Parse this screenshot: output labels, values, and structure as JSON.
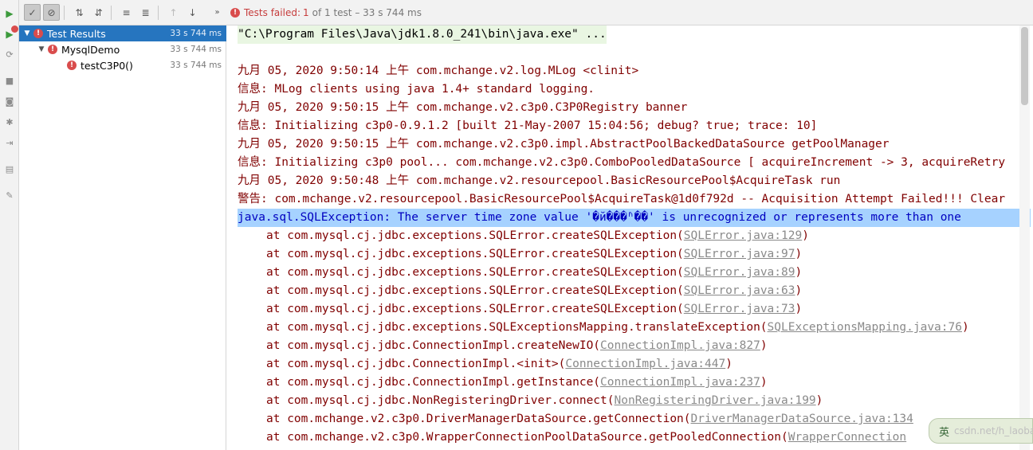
{
  "toolbar": {
    "status_fail": "Tests failed:",
    "status_count": "1",
    "status_rest": "of 1 test – 33 s 744 ms"
  },
  "tree": {
    "items": [
      {
        "label": "Test Results",
        "duration": "33 s 744 ms"
      },
      {
        "label": "MysqlDemo",
        "duration": "33 s 744 ms"
      },
      {
        "label": "testC3P0()",
        "duration": "33 s 744 ms"
      }
    ]
  },
  "console": {
    "command": "\"C:\\Program Files\\Java\\jdk1.8.0_241\\bin\\java.exe\" ...",
    "lines": [
      "九月 05, 2020 9:50:14 上午 com.mchange.v2.log.MLog <clinit>",
      "信息: MLog clients using java 1.4+ standard logging.",
      "九月 05, 2020 9:50:15 上午 com.mchange.v2.c3p0.C3P0Registry banner",
      "信息: Initializing c3p0-0.9.1.2 [built 21-May-2007 15:04:56; debug? true; trace: 10]",
      "九月 05, 2020 9:50:15 上午 com.mchange.v2.c3p0.impl.AbstractPoolBackedDataSource getPoolManager",
      "信息: Initializing c3p0 pool... com.mchange.v2.c3p0.ComboPooledDataSource [ acquireIncrement -> 3, acquireRetry",
      "九月 05, 2020 9:50:48 上午 com.mchange.v2.resourcepool.BasicResourcePool$AcquireTask run",
      "警告: com.mchange.v2.resourcepool.BasicResourcePool$AcquireTask@1d0f792d -- Acquisition Attempt Failed!!! Clear"
    ],
    "exception": "java.sql.SQLException: The server time zone value '�й���ʱ��' is unrecognized or represents more than one",
    "stack": [
      {
        "text": "at com.mysql.cj.jdbc.exceptions.SQLError.createSQLException(",
        "link": "SQLError.java:129",
        "end": ")"
      },
      {
        "text": "at com.mysql.cj.jdbc.exceptions.SQLError.createSQLException(",
        "link": "SQLError.java:97",
        "end": ")"
      },
      {
        "text": "at com.mysql.cj.jdbc.exceptions.SQLError.createSQLException(",
        "link": "SQLError.java:89",
        "end": ")"
      },
      {
        "text": "at com.mysql.cj.jdbc.exceptions.SQLError.createSQLException(",
        "link": "SQLError.java:63",
        "end": ")"
      },
      {
        "text": "at com.mysql.cj.jdbc.exceptions.SQLError.createSQLException(",
        "link": "SQLError.java:73",
        "end": ")"
      },
      {
        "text": "at com.mysql.cj.jdbc.exceptions.SQLExceptionsMapping.translateException(",
        "link": "SQLExceptionsMapping.java:76",
        "end": ")"
      },
      {
        "text": "at com.mysql.cj.jdbc.ConnectionImpl.createNewIO(",
        "link": "ConnectionImpl.java:827",
        "end": ")"
      },
      {
        "text": "at com.mysql.cj.jdbc.ConnectionImpl.<init>(",
        "link": "ConnectionImpl.java:447",
        "end": ")"
      },
      {
        "text": "at com.mysql.cj.jdbc.ConnectionImpl.getInstance(",
        "link": "ConnectionImpl.java:237",
        "end": ")"
      },
      {
        "text": "at com.mysql.cj.jdbc.NonRegisteringDriver.connect(",
        "link": "NonRegisteringDriver.java:199",
        "end": ")"
      },
      {
        "text": "at com.mchange.v2.c3p0.DriverManagerDataSource.getConnection(",
        "link": "DriverManagerDataSource.java:134",
        "end": ""
      },
      {
        "text": "at com.mchange.v2.c3p0.WrapperConnectionPoolDataSource.getPooledConnection(",
        "link": "WrapperConnection",
        "end": ""
      }
    ]
  },
  "ime": {
    "label": "英",
    "watermark": "csdn.net/h_laobai"
  }
}
